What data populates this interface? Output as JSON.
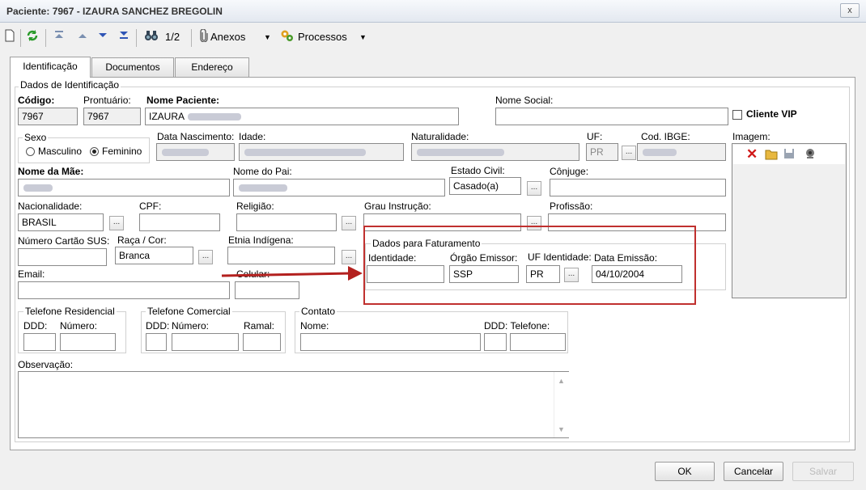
{
  "window": {
    "title": "Paciente: 7967 - IZAURA SANCHEZ BREGOLIN",
    "close_glyph": "x"
  },
  "toolbar": {
    "page_indicator": "1/2",
    "attachments": "Anexos",
    "processes": "Processos"
  },
  "tabs": [
    "Identificação",
    "Documentos",
    "Endereço"
  ],
  "identification": {
    "section_title": "Dados de Identificação",
    "codigo_label": "Código:",
    "codigo_value": "7967",
    "prontuario_label": "Prontuário:",
    "prontuario_value": "7967",
    "nome_label": "Nome Paciente:",
    "nome_value": "IZAURA",
    "nome_social_label": "Nome Social:",
    "vip_label": "Cliente VIP",
    "sexo_label": "Sexo",
    "masculino": "Masculino",
    "feminino": "Feminino",
    "nascimento_label": "Data Nascimento:",
    "idade_label": "Idade:",
    "naturalidade_label": "Naturalidade:",
    "uf_label": "UF:",
    "uf_value": "PR",
    "ibge_label": "Cod. IBGE:",
    "imagem_label": "Imagem:",
    "mae_label": "Nome da Mãe:",
    "pai_label": "Nome do Pai:",
    "estado_civil_label": "Estado Civil:",
    "estado_civil_value": "Casado(a)",
    "conjuge_label": "Cônjuge:",
    "nacionalidade_label": "Nacionalidade:",
    "nacionalidade_value": "BRASIL",
    "cpf_label": "CPF:",
    "religiao_label": "Religião:",
    "grau_label": "Grau Instrução:",
    "profissao_label": "Profissão:",
    "sus_label": "Número Cartão SUS:",
    "raca_label": "Raça / Cor:",
    "raca_value": "Branca",
    "etnia_label": "Etnia Indígena:",
    "email_label": "Email:",
    "celular_label": "Celular:",
    "tel_res_title": "Telefone Residencial",
    "tel_com_title": "Telefone Comercial",
    "ddd_label": "DDD:",
    "numero_label": "Número:",
    "ramal_label": "Ramal:",
    "contato_title": "Contato",
    "contato_nome_label": "Nome:",
    "contato_tel_label": "DDD: Telefone:",
    "obs_label": "Observação:"
  },
  "billing": {
    "title": "Dados para Faturamento",
    "identidade_label": "Identidade:",
    "orgao_label": "Órgão Emissor:",
    "orgao_value": "SSP",
    "uf_label": "UF Identidade:",
    "uf_value": "PR",
    "emissao_label": "Data Emissão:",
    "emissao_value": "04/10/2004"
  },
  "buttons": {
    "ok": "OK",
    "cancel": "Cancelar",
    "save": "Salvar"
  },
  "colors": {
    "highlight": "#c0302e",
    "arrow": "#b3201e"
  }
}
